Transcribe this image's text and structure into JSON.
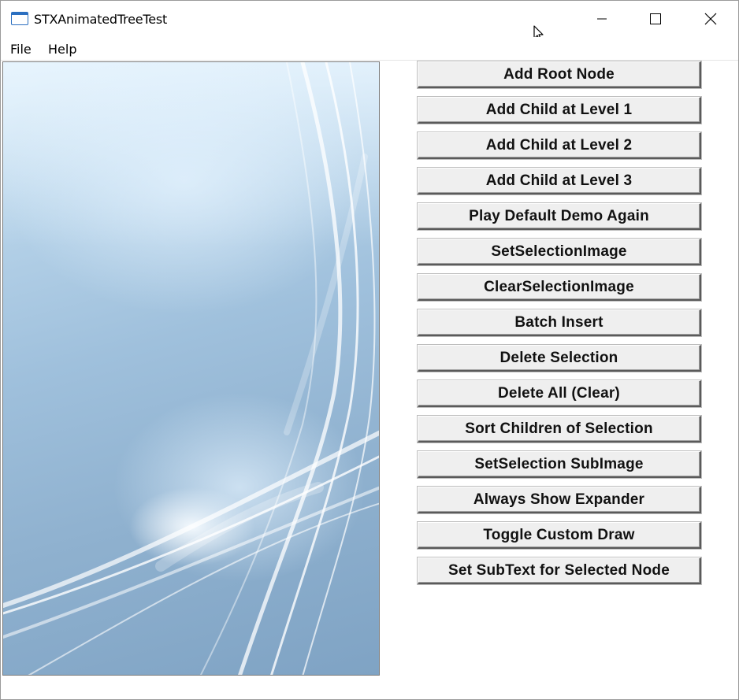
{
  "window": {
    "title": "STXAnimatedTreeTest",
    "controls": [
      "minimize",
      "maximize",
      "close"
    ]
  },
  "menu": {
    "items": [
      "File",
      "Help"
    ]
  },
  "buttons": [
    "Add Root Node",
    "Add Child at Level 1",
    "Add Child at Level 2",
    "Add Child at Level 3",
    "Play Default Demo Again",
    "SetSelectionImage",
    "ClearSelectionImage",
    "Batch Insert",
    "Delete Selection",
    "Delete All (Clear)",
    "Sort Children of Selection",
    "SetSelection SubImage",
    "Always Show Expander",
    "Toggle Custom Draw",
    "Set SubText for Selected Node"
  ],
  "icons": {
    "app": "window-app-icon",
    "cursor": "mouse-pointer-icon"
  },
  "colors": {
    "background_start": "#d9ecf8",
    "background_end": "#7fa3c4",
    "button_face": "#efefef"
  }
}
